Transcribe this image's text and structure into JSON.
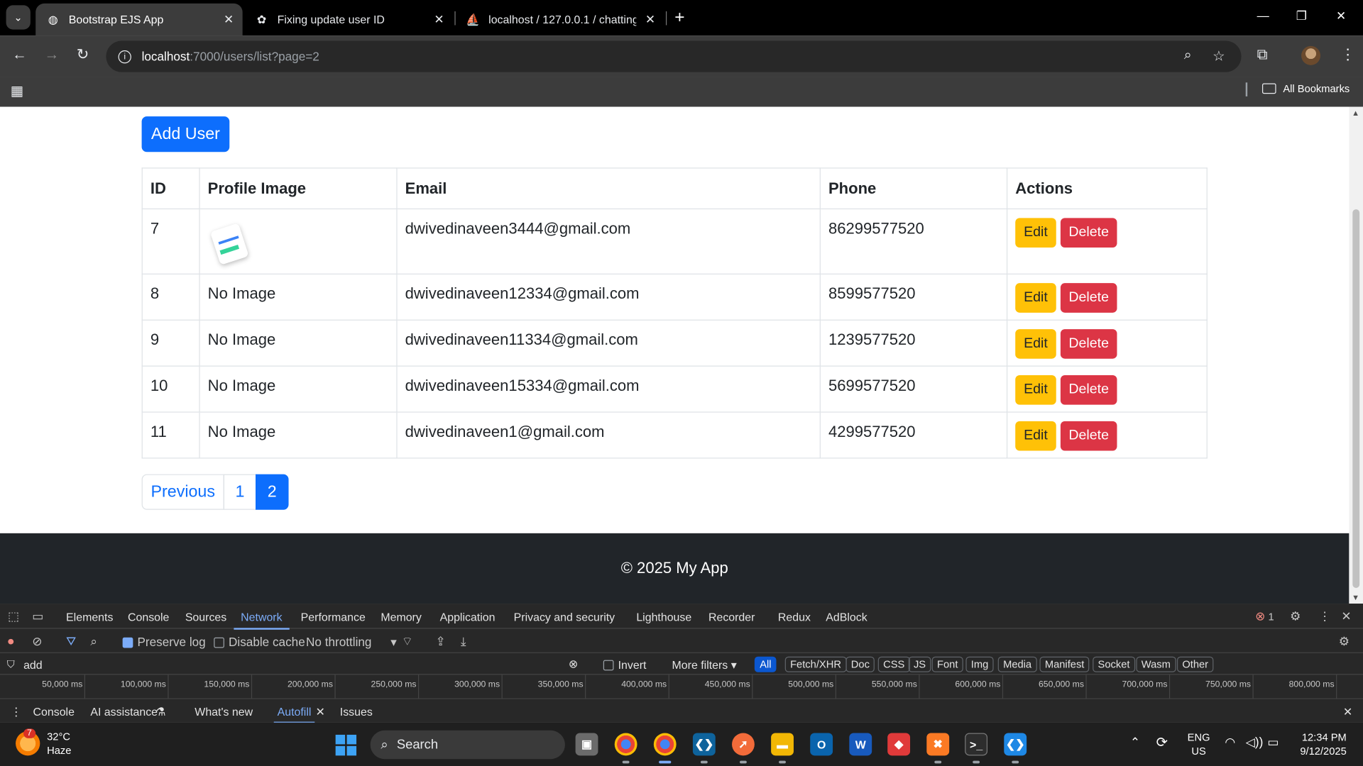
{
  "browser": {
    "tabs": [
      {
        "title": "Bootstrap EJS App",
        "active": true
      },
      {
        "title": "Fixing update user ID",
        "active": false
      },
      {
        "title": "localhost / 127.0.0.1 / chatting-",
        "active": false
      }
    ],
    "url_host": "localhost",
    "url_path": ":7000/users/list?page=2",
    "bookmarks_label": "All Bookmarks"
  },
  "page": {
    "add_user_label": "Add User",
    "table": {
      "headers": [
        "ID",
        "Profile Image",
        "Email",
        "Phone",
        "Actions"
      ],
      "rows": [
        {
          "id": "7",
          "image": "",
          "email": "dwivedinaveen3444@gmail.com",
          "phone": "86299577520"
        },
        {
          "id": "8",
          "image": "No Image",
          "email": "dwivedinaveen12334@gmail.com",
          "phone": "8599577520"
        },
        {
          "id": "9",
          "image": "No Image",
          "email": "dwivedinaveen11334@gmail.com",
          "phone": "1239577520"
        },
        {
          "id": "10",
          "image": "No Image",
          "email": "dwivedinaveen15334@gmail.com",
          "phone": "5699577520"
        },
        {
          "id": "11",
          "image": "No Image",
          "email": "dwivedinaveen1@gmail.com",
          "phone": "4299577520"
        }
      ],
      "edit_label": "Edit",
      "delete_label": "Delete"
    },
    "pagination": {
      "previous": "Previous",
      "pages": [
        "1",
        "2"
      ],
      "current": "2"
    },
    "footer": "© 2025 My App"
  },
  "devtools": {
    "tabs": [
      "Elements",
      "Console",
      "Sources",
      "Network",
      "Performance",
      "Memory",
      "Application",
      "Privacy and security",
      "Lighthouse",
      "Recorder",
      "Redux",
      "AdBlock"
    ],
    "active_tab": "Network",
    "error_count": "1",
    "preserve_log": "Preserve log",
    "disable_cache": "Disable cache",
    "throttling": "No throttling",
    "filter_value": "add",
    "invert": "Invert",
    "more_filters": "More filters",
    "type_filters": [
      "All",
      "Fetch/XHR",
      "Doc",
      "CSS",
      "JS",
      "Font",
      "Img",
      "Media",
      "Manifest",
      "Socket",
      "Wasm",
      "Other"
    ],
    "timeline_ticks": [
      "50,000 ms",
      "100,000 ms",
      "150,000 ms",
      "200,000 ms",
      "250,000 ms",
      "300,000 ms",
      "350,000 ms",
      "400,000 ms",
      "450,000 ms",
      "500,000 ms",
      "550,000 ms",
      "600,000 ms",
      "650,000 ms",
      "700,000 ms",
      "750,000 ms",
      "800,000 ms"
    ],
    "drawer_tabs": [
      "Console",
      "AI assistance",
      "What's new",
      "Autofill",
      "Issues"
    ],
    "drawer_active": "Autofill"
  },
  "taskbar": {
    "weather_badge": "7",
    "temperature": "32°C",
    "condition": "Haze",
    "search_placeholder": "Search",
    "language": "ENG",
    "region": "US",
    "time": "12:34 PM",
    "date": "9/12/2025"
  },
  "colors": {
    "primary": "#0d6efd",
    "warning": "#ffc107",
    "danger": "#dc3545",
    "footer": "#212529"
  }
}
